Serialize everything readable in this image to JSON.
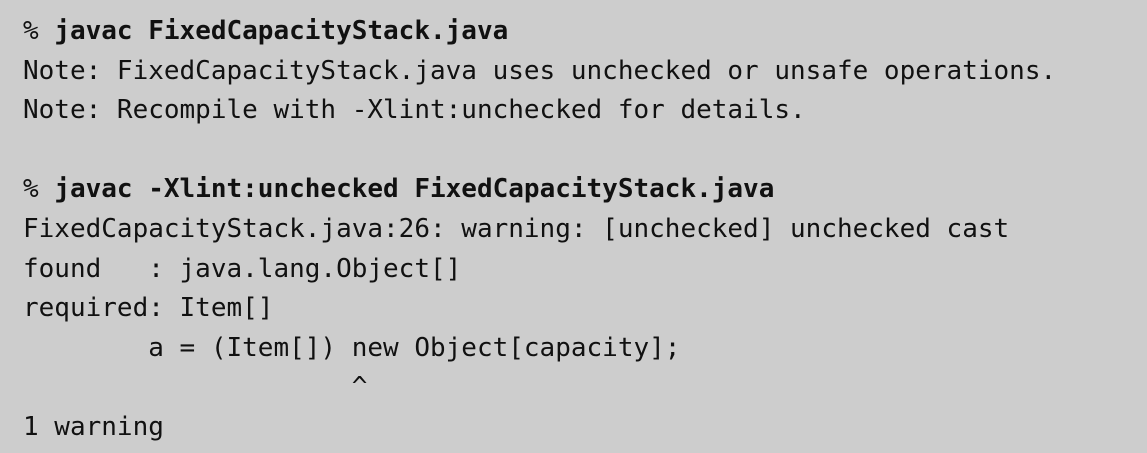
{
  "terminal": {
    "lines": [
      {
        "prompt": "% ",
        "command": "javac FixedCapacityStack.java"
      },
      {
        "text": "Note: FixedCapacityStack.java uses unchecked or unsafe operations."
      },
      {
        "text": "Note: Recompile with -Xlint:unchecked for details."
      },
      {
        "text": ""
      },
      {
        "prompt": "% ",
        "command": "javac -Xlint:unchecked FixedCapacityStack.java"
      },
      {
        "text": "FixedCapacityStack.java:26: warning: [unchecked] unchecked cast"
      },
      {
        "text": "found   : java.lang.Object[]"
      },
      {
        "text": "required: Item[]"
      },
      {
        "text": "        a = (Item[]) new Object[capacity];"
      },
      {
        "text": "                     ^"
      },
      {
        "text": "1 warning"
      }
    ]
  }
}
